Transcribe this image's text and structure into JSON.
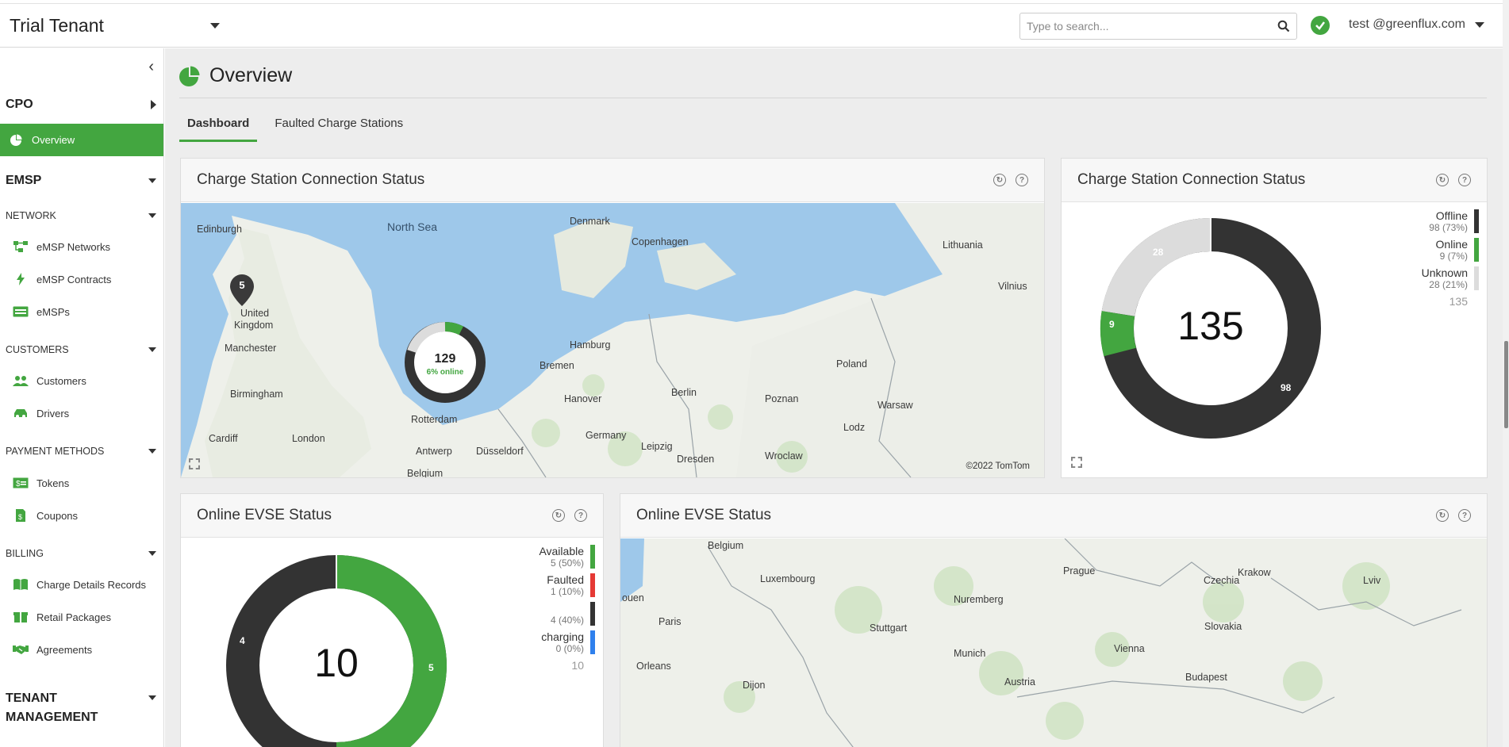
{
  "topbar": {
    "tenant": "Trial Tenant",
    "search_placeholder": "Type to search...",
    "user": "test @greenflux.com"
  },
  "sidebar": {
    "cpo": "CPO",
    "overview": "Overview",
    "emsp": "EMSP",
    "network": "NETWORK",
    "emsp_networks": "eMSP Networks",
    "emsp_contracts": "eMSP Contracts",
    "emsps": "eMSPs",
    "customers_hdr": "CUSTOMERS",
    "customers": "Customers",
    "drivers": "Drivers",
    "payment_methods": "PAYMENT METHODS",
    "tokens": "Tokens",
    "coupons": "Coupons",
    "billing": "BILLING",
    "cdr": "Charge Details Records",
    "retail_packages": "Retail Packages",
    "agreements": "Agreements",
    "tenant_mgmt_1": "TENANT",
    "tenant_mgmt_2": "MANAGEMENT"
  },
  "page": {
    "title": "Overview",
    "tabs": [
      "Dashboard",
      "Faulted Charge Stations"
    ]
  },
  "card1": {
    "title": "Charge Station Connection Status",
    "cluster_count": "129",
    "cluster_sub": "6% online",
    "pin_count": "5",
    "attribution": "©2022 TomTom",
    "labels": [
      "North Sea",
      "Edinburgh",
      "Denmark",
      "Copenhagen",
      "Lithuania",
      "Vilnius",
      "United",
      "Kingdom",
      "Manchester",
      "Birmingham",
      "Cardiff",
      "London",
      "Hamburg",
      "Bremen",
      "Hanover",
      "Berlin",
      "Poland",
      "Poznan",
      "Warsaw",
      "Lodz",
      "Rotterdam",
      "Antwerp",
      "Düsseldorf",
      "Germany",
      "Leipzig",
      "Dresden",
      "Wroclaw",
      "Belgium"
    ]
  },
  "card2": {
    "title": "Charge Station Connection Status",
    "total": "135",
    "seg_offline": "98",
    "seg_online": "9",
    "seg_unknown": "28",
    "legend": [
      {
        "name": "Offline",
        "value": "98 (73%)",
        "color": "#333333"
      },
      {
        "name": "Online",
        "value": "9 (7%)",
        "color": "#43a640"
      },
      {
        "name": "Unknown",
        "value": "28 (21%)",
        "color": "#dcdcdc"
      }
    ],
    "legend_total": "135"
  },
  "card3": {
    "title": "Online EVSE Status",
    "total": "10",
    "seg_available": "5",
    "seg_black": "4",
    "legend": [
      {
        "name": "Available",
        "value": "5 (50%)",
        "color": "#43a640"
      },
      {
        "name": "Faulted",
        "value": "1 (10%)",
        "color": "#e53935"
      },
      {
        "name": "",
        "value": "4 (40%)",
        "color": "#333333"
      },
      {
        "name": "charging",
        "value": "0 (0%)",
        "color": "#2f80ed"
      }
    ],
    "legend_total": "10"
  },
  "card4": {
    "title": "Online EVSE Status",
    "labels": [
      "Belgium",
      "Luxembourg",
      "Prague",
      "Czechia",
      "Krakow",
      "Lviv",
      "Nuremberg",
      "Paris",
      "ouen",
      "Stuttgart",
      "Slovakia",
      "Munich",
      "Vienna",
      "Orleans",
      "Austria",
      "Budapest",
      "Dijon"
    ]
  }
}
